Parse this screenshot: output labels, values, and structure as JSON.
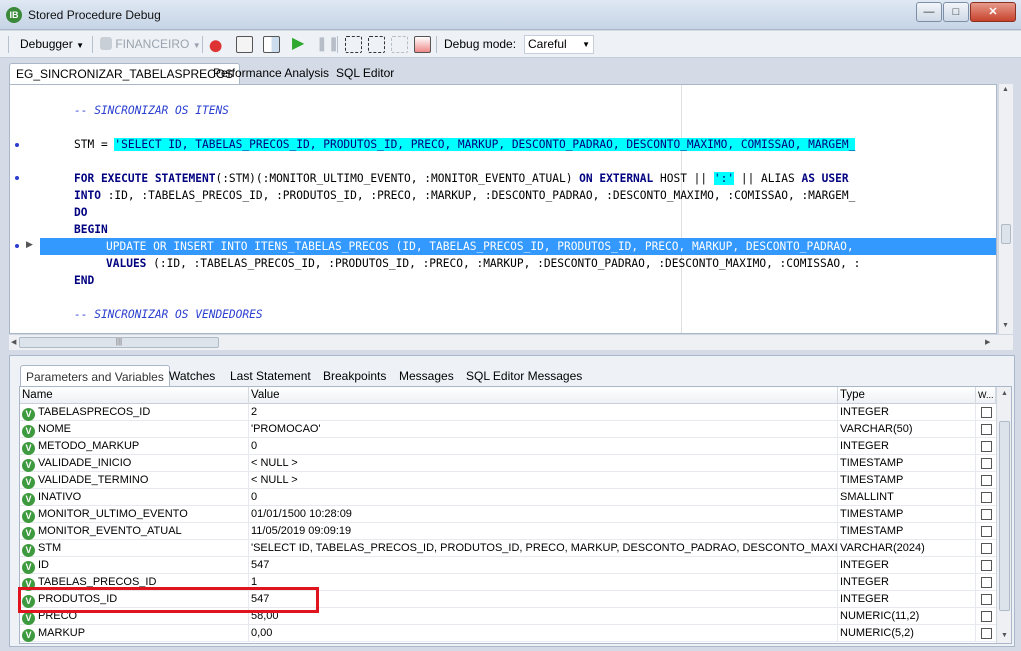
{
  "window": {
    "title": "Stored Procedure Debug",
    "app_icon": "IB"
  },
  "toolbar": {
    "debugger_label": "Debugger",
    "database_label": "FINANCEIRO",
    "debug_mode_label": "Debug mode:",
    "debug_mode_value": "Careful"
  },
  "editor_tabs": [
    "EG_SINCRONIZAR_TABELASPRECOS",
    "Performance Analysis",
    "SQL Editor"
  ],
  "code": {
    "comment1": "-- SINCRONIZAR OS ITENS",
    "stm_prefix": "STM = ",
    "stm_string": "'SELECT ID, TABELAS_PRECOS_ID, PRODUTOS_ID, PRECO, MARKUP, DESCONTO_PADRAO, DESCONTO_MAXIMO, COMISSAO, MARGEM_",
    "for_line_a": "FOR EXECUTE STATEMENT",
    "for_line_b": "(:STM)(:MONITOR_ULTIMO_EVENTO, :MONITOR_EVENTO_ATUAL) ",
    "for_line_c": "ON EXTERNAL",
    "for_line_d": " HOST || ",
    "for_line_str": "':'",
    "for_line_e": " || ALIAS ",
    "for_line_f": "AS USER",
    "into_kw": "INTO",
    "into_rest": " :ID, :TABELAS_PRECOS_ID, :PRODUTOS_ID, :PRECO, :MARKUP, :DESCONTO_PADRAO, :DESCONTO_MAXIMO, :COMISSAO, :MARGEM_",
    "do_kw": "DO",
    "begin_kw": "BEGIN",
    "update_line": "UPDATE OR INSERT INTO ITENS_TABELAS_PRECOS (ID, TABELAS_PRECOS_ID, PRODUTOS_ID, PRECO, MARKUP, DESCONTO_PADRAO,",
    "values_kw": "VALUES",
    "values_rest": " (:ID, :TABELAS_PRECOS_ID, :PRODUTOS_ID, :PRECO, :MARKUP, :DESCONTO_PADRAO, :DESCONTO_MAXIMO, :COMISSAO, :",
    "end_kw": "END",
    "comment2": "-- SINCRONIZAR OS VENDEDORES"
  },
  "panel_tabs": [
    "Parameters and Variables",
    "Watches",
    "Last Statement",
    "Breakpoints",
    "Messages",
    "SQL Editor Messages"
  ],
  "grid": {
    "columns": [
      "Name",
      "Value",
      "Type",
      "W..."
    ],
    "rows": [
      {
        "name": "TABELASPRECOS_ID",
        "value": "2",
        "type": "INTEGER"
      },
      {
        "name": "NOME",
        "value": "'PROMOCAO'",
        "type": "VARCHAR(50)"
      },
      {
        "name": "METODO_MARKUP",
        "value": "0",
        "type": "INTEGER"
      },
      {
        "name": "VALIDADE_INICIO",
        "value": "< NULL >",
        "type": "TIMESTAMP"
      },
      {
        "name": "VALIDADE_TERMINO",
        "value": "< NULL >",
        "type": "TIMESTAMP"
      },
      {
        "name": "INATIVO",
        "value": "0",
        "type": "SMALLINT"
      },
      {
        "name": "MONITOR_ULTIMO_EVENTO",
        "value": "01/01/1500 10:28:09",
        "type": "TIMESTAMP"
      },
      {
        "name": "MONITOR_EVENTO_ATUAL",
        "value": "11/05/2019 09:09:19",
        "type": "TIMESTAMP"
      },
      {
        "name": "STM",
        "value": "'SELECT ID, TABELAS_PRECOS_ID, PRODUTOS_ID, PRECO, MARKUP, DESCONTO_PADRAO, DESCONTO_MAXIMO, C...",
        "type": "VARCHAR(2024)"
      },
      {
        "name": "ID",
        "value": "547",
        "type": "INTEGER"
      },
      {
        "name": "TABELAS_PRECOS_ID",
        "value": "1",
        "type": "INTEGER"
      },
      {
        "name": "PRODUTOS_ID",
        "value": "547",
        "type": "INTEGER"
      },
      {
        "name": "PRECO",
        "value": "58,00",
        "type": "NUMERIC(11,2)"
      },
      {
        "name": "MARKUP",
        "value": "0,00",
        "type": "NUMERIC(5,2)"
      }
    ]
  },
  "colors": {
    "highlight": "#3399ff",
    "string_bg": "#00ffff",
    "annotation": "#e0141e"
  }
}
